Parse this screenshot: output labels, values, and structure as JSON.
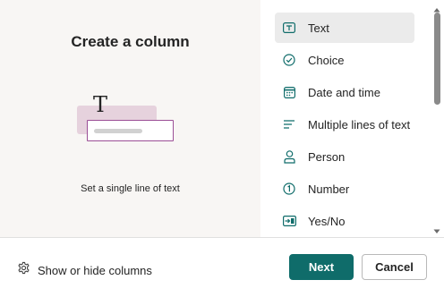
{
  "preview": {
    "title": "Create a column",
    "illustration_glyph": "T",
    "description": "Set a single line of text"
  },
  "column_types": [
    {
      "label": "Text",
      "icon": "text-box-icon",
      "selected": true
    },
    {
      "label": "Choice",
      "icon": "circle-check-icon",
      "selected": false
    },
    {
      "label": "Date and time",
      "icon": "calendar-icon",
      "selected": false
    },
    {
      "label": "Multiple lines of text",
      "icon": "lines-icon",
      "selected": false
    },
    {
      "label": "Person",
      "icon": "person-icon",
      "selected": false
    },
    {
      "label": "Number",
      "icon": "number-circle-icon",
      "selected": false
    },
    {
      "label": "Yes/No",
      "icon": "toggle-box-icon",
      "selected": false
    }
  ],
  "footer": {
    "show_hide_label": "Show or hide columns",
    "next_label": "Next",
    "cancel_label": "Cancel"
  },
  "colors": {
    "accent": "#0f6c6a",
    "preview_bg": "#f8f6f4",
    "selected_bg": "#ebebeb",
    "illustration_border": "#9b4f96"
  }
}
